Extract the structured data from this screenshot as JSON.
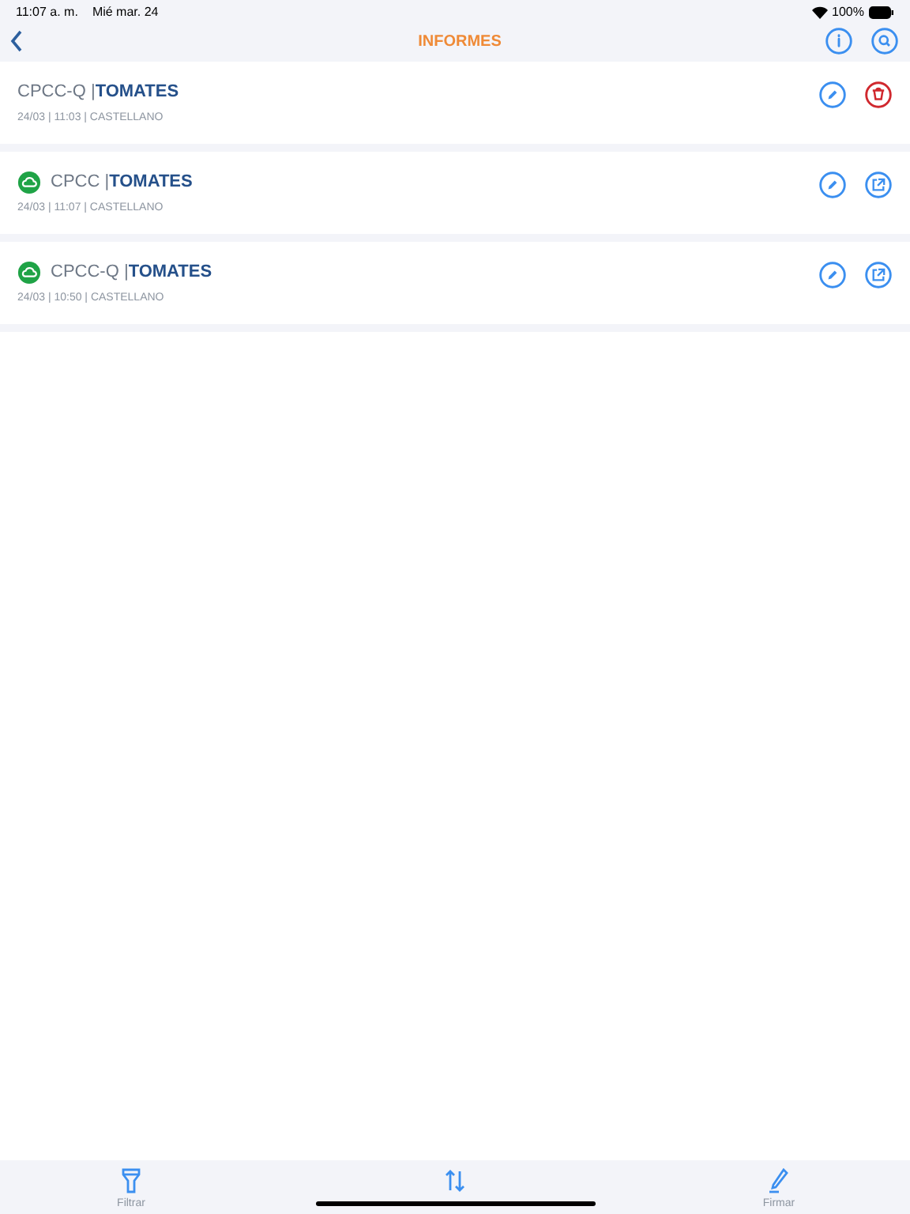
{
  "status_bar": {
    "time": "11:07 a. m.",
    "date": "Mié mar. 24",
    "battery": "100%"
  },
  "nav": {
    "title": "INFORMES"
  },
  "reports": [
    {
      "code": "CPCC-Q |",
      "product": "TOMATES",
      "meta": "24/03 | 11:03 | CASTELLANO",
      "synced": false,
      "kind": "delete"
    },
    {
      "code": "CPCC |",
      "product": "TOMATES",
      "meta": "24/03 | 11:07 | CASTELLANO",
      "synced": true,
      "kind": "export"
    },
    {
      "code": "CPCC-Q |",
      "product": "TOMATES",
      "meta": "24/03 | 10:50 | CASTELLANO",
      "synced": true,
      "kind": "export"
    }
  ],
  "tab_bar": [
    {
      "kind": "filter",
      "label": "Filtrar"
    },
    {
      "kind": "sort"
    },
    {
      "kind": "sign",
      "label": "Firmar"
    }
  ]
}
